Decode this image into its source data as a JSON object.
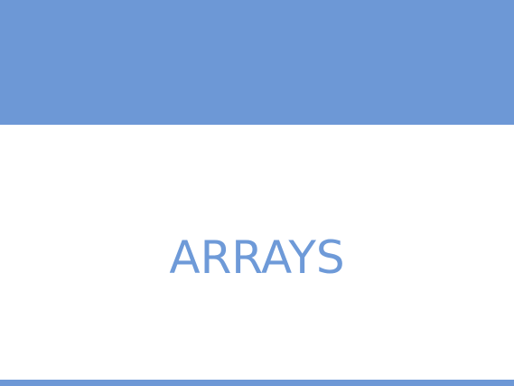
{
  "slide": {
    "title": "ARRAYS"
  },
  "colors": {
    "band": "#6d98d6",
    "title": "#6e9ad8",
    "background": "#ffffff"
  }
}
